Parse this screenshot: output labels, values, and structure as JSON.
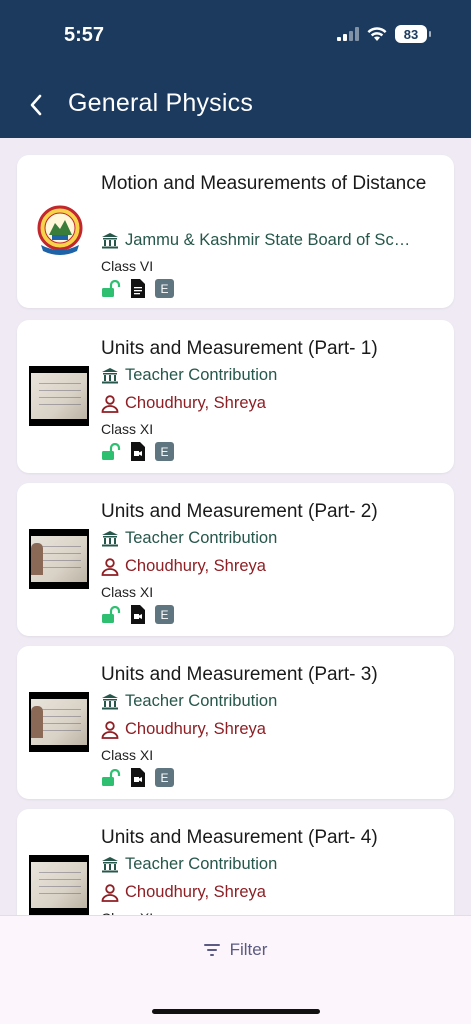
{
  "status_bar": {
    "time": "5:57",
    "battery": "83"
  },
  "header": {
    "title": "General Physics"
  },
  "items": [
    {
      "title": "Motion and Measurements of Distance",
      "institution": "Jammu & Kashmir State Board of Sc…",
      "class": "Class VI"
    },
    {
      "title": "Units and Measurement (Part- 1)",
      "institution": "Teacher Contribution",
      "author": "Choudhury, Shreya",
      "class": "Class XI"
    },
    {
      "title": "Units and Measurement (Part- 2)",
      "institution": "Teacher Contribution",
      "author": "Choudhury, Shreya",
      "class": "Class XI"
    },
    {
      "title": "Units and Measurement (Part- 3)",
      "institution": "Teacher Contribution",
      "author": "Choudhury, Shreya",
      "class": "Class XI"
    },
    {
      "title": "Units and Measurement (Part- 4)",
      "institution": "Teacher Contribution",
      "author": "Choudhury, Shreya",
      "class": "Class XI"
    }
  ],
  "badge_label": "E",
  "footer": {
    "filter_label": "Filter"
  },
  "colors": {
    "header_bg": "#1b3a5e",
    "institution": "#26574a",
    "author": "#8e1f24",
    "unlocked": "#2fbf71"
  }
}
